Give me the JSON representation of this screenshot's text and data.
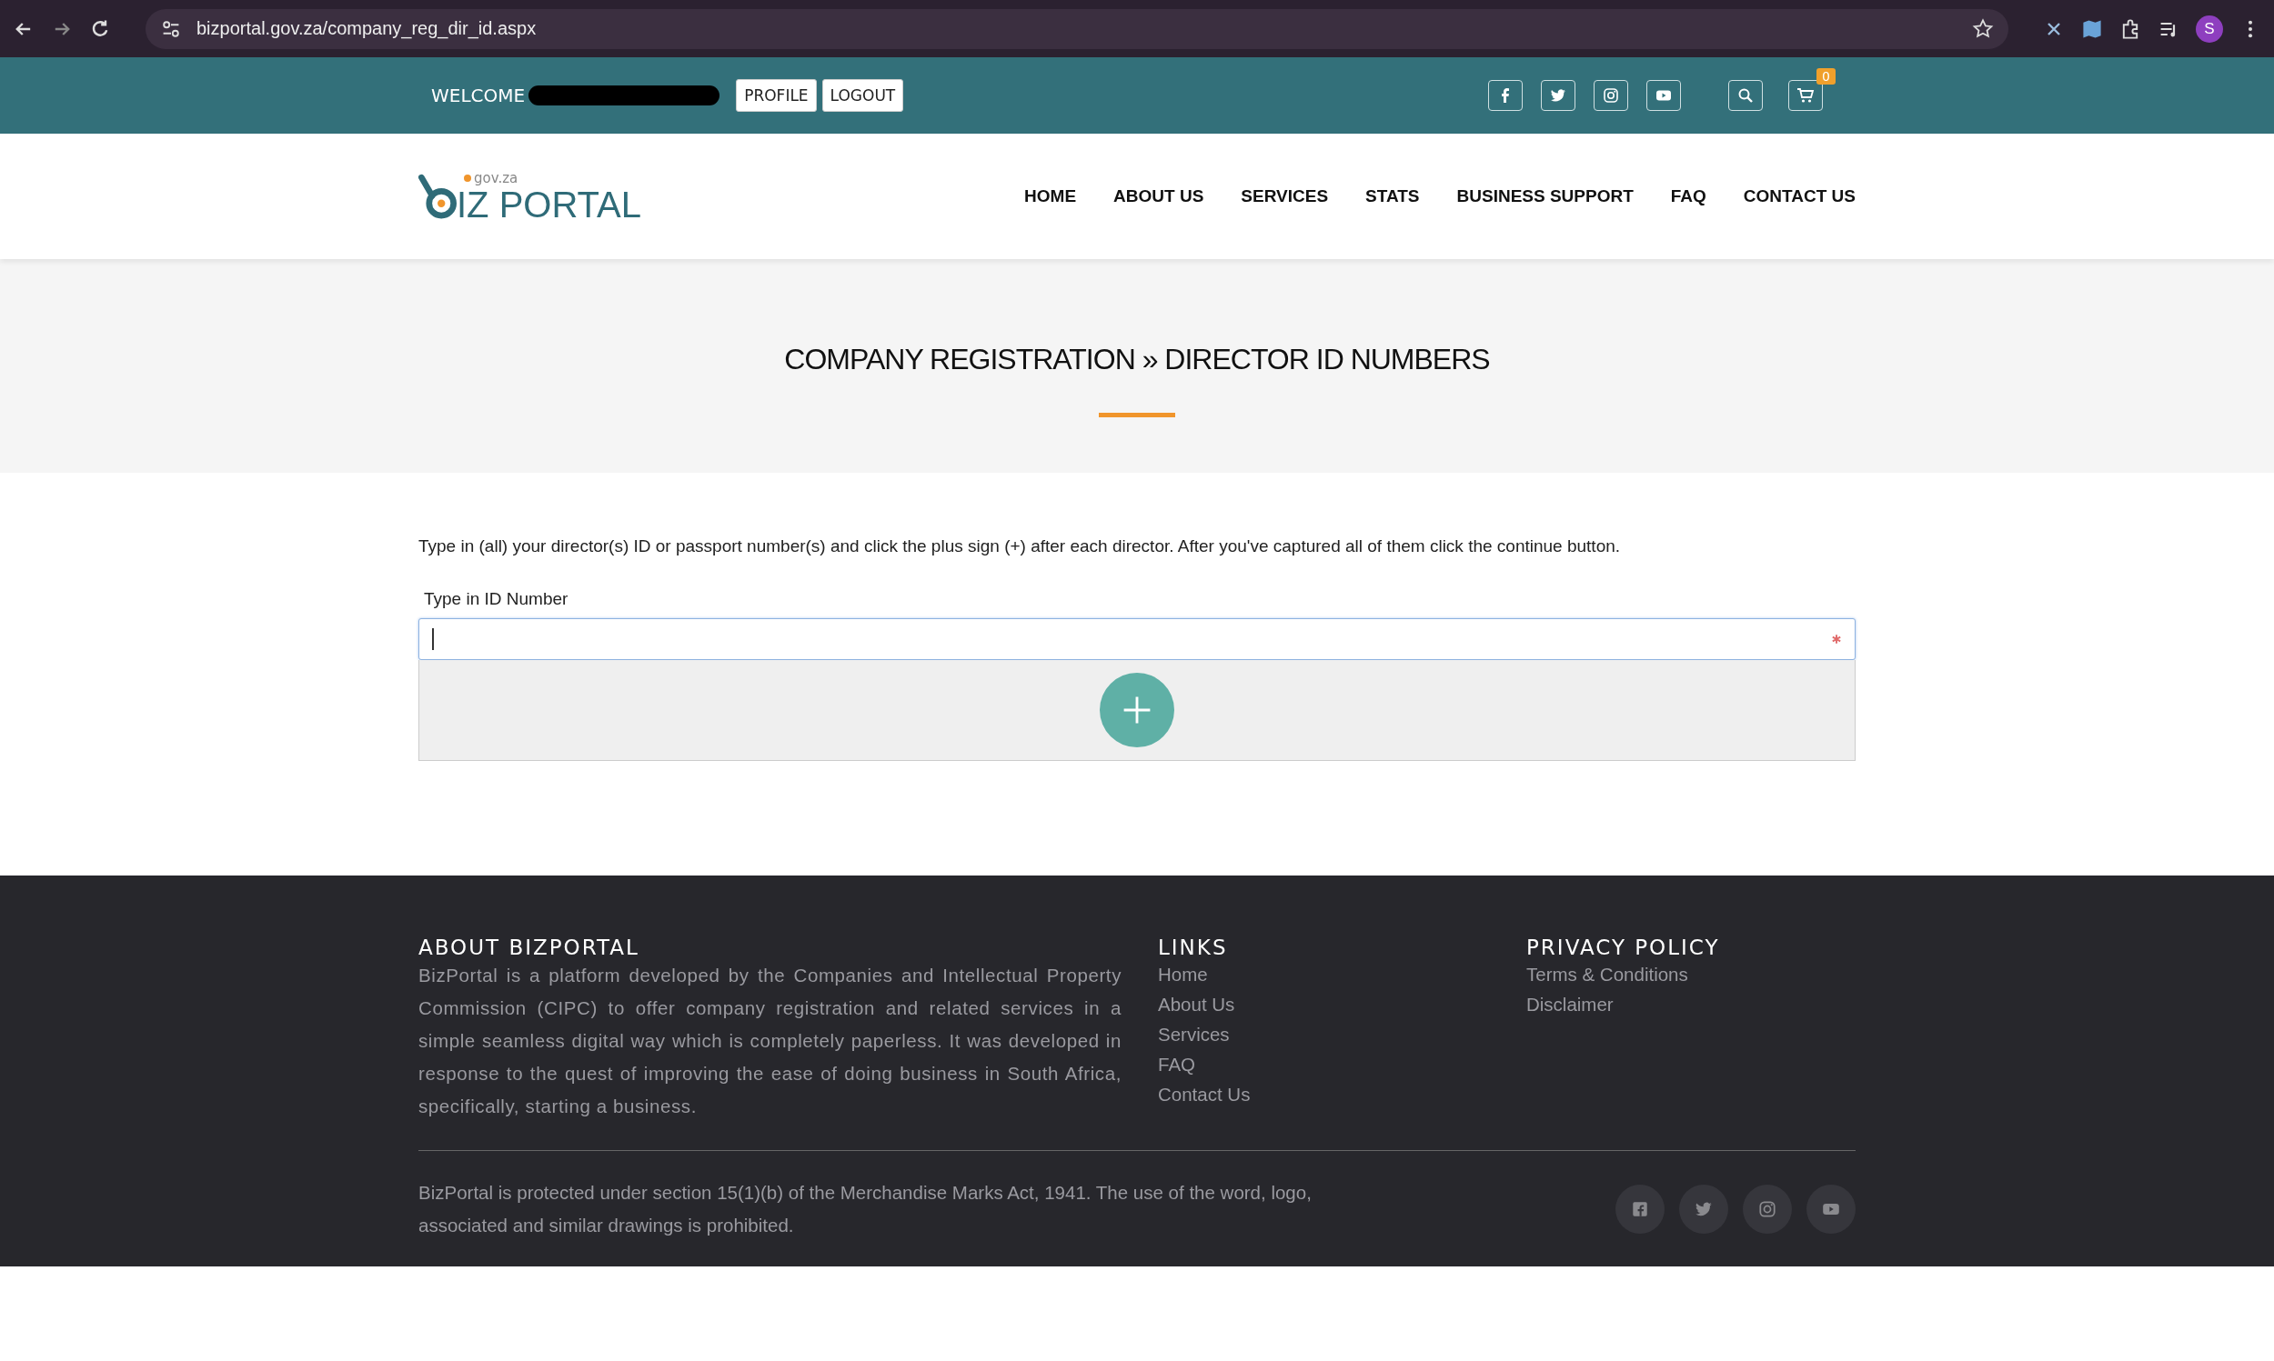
{
  "browser": {
    "url": "bizportal.gov.za/company_reg_dir_id.aspx",
    "profile_initial": "S"
  },
  "topbar": {
    "welcome": "WELCOME",
    "name_redacted": true,
    "buttons": [
      "PROFILE",
      "LOGOUT"
    ],
    "cart_count": "0"
  },
  "nav": {
    "logo_domain": "gov.za",
    "logo_text": "IZ PORTAL",
    "items": [
      {
        "label": "HOME"
      },
      {
        "label": "ABOUT US"
      },
      {
        "label": "SERVICES"
      },
      {
        "label": "STATS"
      },
      {
        "label": "BUSINESS SUPPORT"
      },
      {
        "label": "FAQ"
      },
      {
        "label": "CONTACT US"
      }
    ]
  },
  "page_title": "COMPANY REGISTRATION » DIRECTOR ID NUMBERS",
  "instructions": "Type in (all) your director(s) ID or passport number(s) and click the plus sign (+) after each director. After you've captured all of them click the continue button.",
  "id_field": {
    "label": "Type in ID Number",
    "required": true,
    "focused": true
  },
  "footer": {
    "about": {
      "title": "ABOUT BIZPORTAL",
      "text": "BizPortal is a platform developed by the Companies and Intellectual Property Commission (CIPC) to offer company registration and related services in a simple seamless digital way which is completely paperless. It was developed in response to the quest of improving the ease of doing business in South Africa, specifically, starting a business."
    },
    "links": {
      "title": "LINKS",
      "items": [
        "Home",
        "About Us",
        "Services",
        "FAQ",
        "Contact Us"
      ]
    },
    "privacy": {
      "title": "PRIVACY POLICY",
      "items": [
        "Terms & Conditions",
        "Disclaimer"
      ]
    },
    "legal": "BizPortal is protected under section 15(1)(b) of the Merchandise Marks Act, 1941. The use of the word, logo, associated and similar drawings is prohibited."
  }
}
